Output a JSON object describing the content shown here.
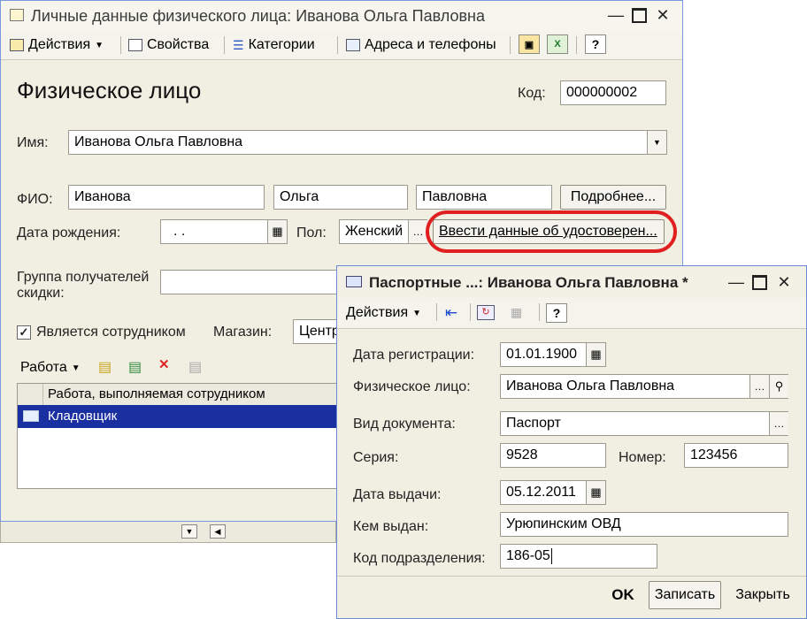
{
  "main": {
    "title": "Личные данные физического лица: Иванова Ольга Павловна",
    "toolbar": {
      "actions": "Действия",
      "properties": "Свойства",
      "categories": "Категории",
      "addresses": "Адреса и телефоны",
      "help": "?"
    },
    "heading": "Физическое лицо",
    "code_label": "Код:",
    "code_value": "000000002",
    "name_label": "Имя:",
    "name_value": "Иванова Ольга Павловна",
    "fio_label": "ФИО:",
    "last_name": "Иванова",
    "first_name": "Ольга",
    "middle_name": "Павловна",
    "details_button": "Подробнее...",
    "birth_label": "Дата рождения:",
    "birth_value": ". .",
    "sex_label": "Пол:",
    "sex_value": "Женский",
    "id_link": "Ввести данные об удостоверен...",
    "group_label_line1": "Группа получателей",
    "group_label_line2": "скидки:",
    "employee_label": "Является сотрудником",
    "store_label": "Магазин:",
    "store_value": "Центр",
    "work_menu": "Работа",
    "table": {
      "header": "Работа, выполняемая сотрудником",
      "rows": [
        "Кладовщик"
      ]
    },
    "highlight_color": "#e02020"
  },
  "passport": {
    "title": "Паспортные ...: Иванова Ольга Павловна *",
    "actions": "Действия",
    "help": "?",
    "reg_date_label": "Дата регистрации:",
    "reg_date_value": "01.01.1900",
    "person_label": "Физическое лицо:",
    "person_value": "Иванова Ольга Павловна",
    "doc_type_label": "Вид документа:",
    "doc_type_value": "Паспорт",
    "series_label": "Серия:",
    "series_value": "9528",
    "number_label": "Номер:",
    "number_value": "123456",
    "issue_date_label": "Дата выдачи:",
    "issue_date_value": "05.12.2011",
    "issued_by_label": "Кем выдан:",
    "issued_by_value": "Урюпинским ОВД",
    "dept_code_label": "Код подразделения:",
    "dept_code_value": "186-05",
    "ok_button": "OK",
    "save_button": "Записать",
    "close_button": "Закрыть"
  }
}
